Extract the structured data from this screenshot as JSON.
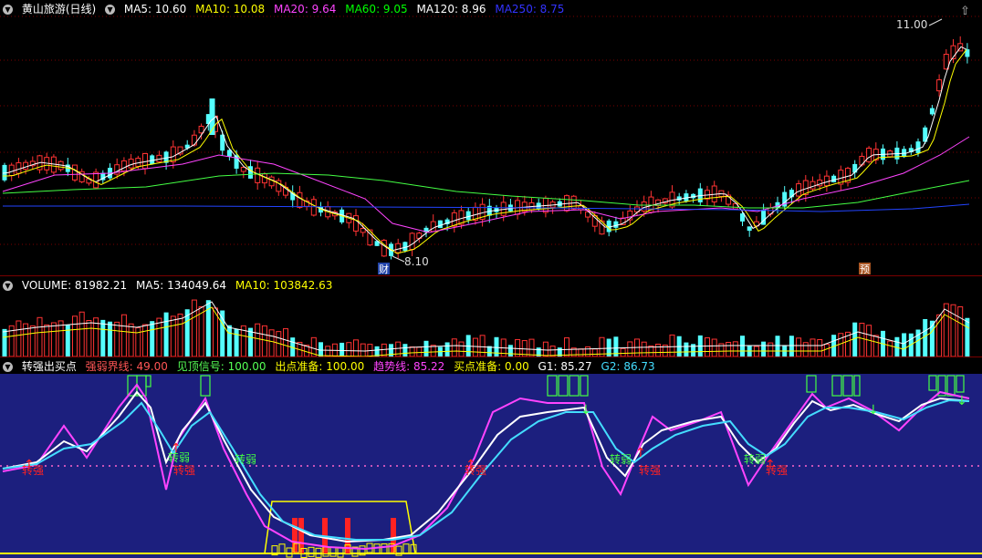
{
  "price_panel": {
    "stock_title": "黄山旅游(日线)",
    "ma": [
      {
        "label": "MA5: 10.60",
        "color": "#ffffff"
      },
      {
        "label": "MA10: 10.08",
        "color": "#ffff00"
      },
      {
        "label": "MA20: 9.64",
        "color": "#ff44ff"
      },
      {
        "label": "MA60: 9.05",
        "color": "#00ff00"
      },
      {
        "label": "MA120: 8.96",
        "color": "#ffffff"
      },
      {
        "label": "MA250: 8.75",
        "color": "#2222ff"
      }
    ],
    "high_marker": "11.00",
    "low_marker": "8.10",
    "tag_fin": "财",
    "tag_pre": "预"
  },
  "volume_panel": {
    "label_volume": "VOLUME: 81982.21",
    "label_ma5": "MA5: 134049.64",
    "label_ma10": "MA10: 103842.63"
  },
  "indicator_panel": {
    "title": "转强出买点",
    "params": [
      {
        "label": "强弱界线: 49.00",
        "color": "#ff5555"
      },
      {
        "label": "见顶信号: 100.00",
        "color": "#55ff55"
      },
      {
        "label": "出点准备: 100.00",
        "color": "#ffff00"
      },
      {
        "label": "趋势线: 85.22",
        "color": "#ff44ff"
      },
      {
        "label": "买点准备: 0.00",
        "color": "#ffff00"
      },
      {
        "label": "G1: 85.27",
        "color": "#ffffff"
      },
      {
        "label": "G2: 86.73",
        "color": "#44ddff"
      }
    ],
    "label_strong": "转强",
    "label_weak": "转弱"
  },
  "colors": {
    "up": "#ff3333",
    "down": "#54ffff",
    "grid": "#7a0000",
    "indicator_bg": "#1c1f7e"
  }
}
